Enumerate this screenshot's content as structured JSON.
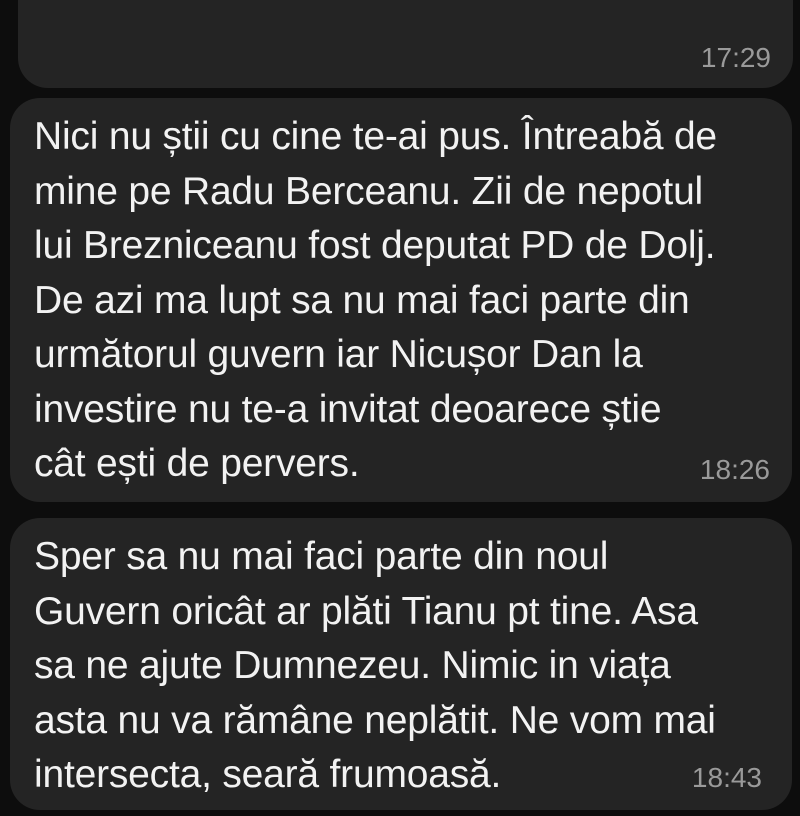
{
  "messages": [
    {
      "text": "",
      "time": "17:29"
    },
    {
      "text": "Nici nu știi cu cine te-ai pus. Întreabă de\nmine pe Radu Berceanu. Zii de nepotul\nlui Brezniceanu fost deputat PD de Dolj.\nDe azi ma lupt sa nu mai faci parte din\nurmătorul guvern iar Nicușor Dan la\ninvestire nu te-a invitat deoarece știe\ncât ești de pervers.",
      "time": "18:26"
    },
    {
      "text": "Sper sa nu mai faci parte din noul\nGuvern oricât ar plăti Tianu pt tine. Asa\nsa ne ajute Dumnezeu. Nimic in viața\nasta nu va rămâne neplătit. Ne vom mai\nintersecta, seară frumoasă.",
      "time": "18:43"
    }
  ]
}
